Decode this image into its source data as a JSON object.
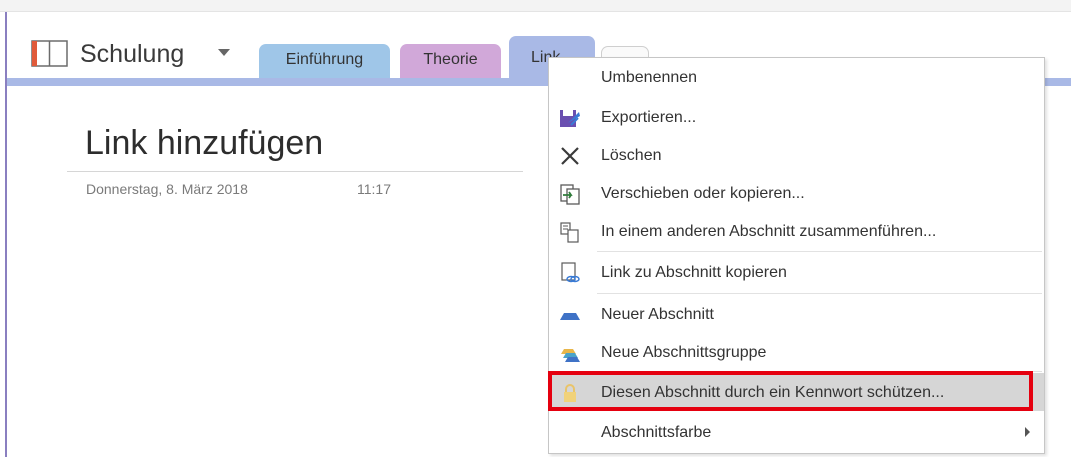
{
  "notebook": {
    "title": "Schulung"
  },
  "tabs": [
    {
      "label": "Einführung"
    },
    {
      "label": "Theorie"
    },
    {
      "label": "Link"
    },
    {
      "label": ""
    }
  ],
  "page": {
    "title": "Link hinzufügen",
    "date": "Donnerstag, 8. März 2018",
    "time": "11:17"
  },
  "context_menu": {
    "items": [
      {
        "label": "Umbenennen",
        "icon": "none"
      },
      {
        "label": "Exportieren...",
        "icon": "export-icon"
      },
      {
        "label": "Löschen",
        "icon": "delete-x-icon"
      },
      {
        "label": "Verschieben oder kopieren...",
        "icon": "move-copy-icon"
      },
      {
        "label": "In einem anderen Abschnitt zusammenführen...",
        "icon": "merge-icon"
      },
      {
        "label": "Link zu Abschnitt kopieren",
        "icon": "copy-link-icon"
      },
      {
        "label": "Neuer Abschnitt",
        "icon": "new-section-icon"
      },
      {
        "label": "Neue Abschnittsgruppe",
        "icon": "new-section-group-icon"
      },
      {
        "label": "Diesen Abschnitt durch ein Kennwort schützen...",
        "icon": "lock-icon",
        "highlighted": true
      },
      {
        "label": "Abschnittsfarbe",
        "icon": "none",
        "has_submenu": true
      }
    ]
  },
  "colors": {
    "tab_einfuehrung": "#9fc6e8",
    "tab_theorie": "#d1a8d9",
    "tab_link": "#a9b9e6",
    "highlight_border": "#e5000f",
    "menu_hover": "#d6d6d6"
  }
}
